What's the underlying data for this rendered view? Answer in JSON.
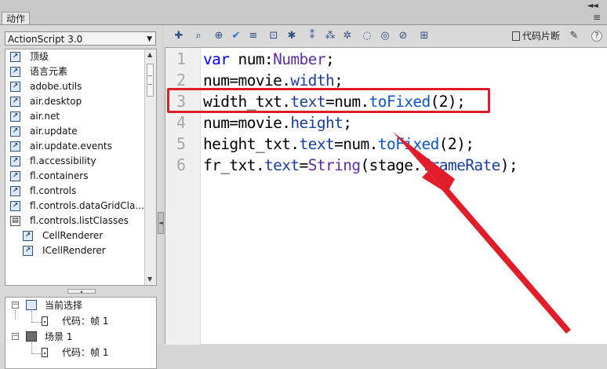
{
  "panel": {
    "tab_label": "动作",
    "collapse_glyph": "◄◄",
    "menu_glyph": "≡"
  },
  "left": {
    "dropdown_value": "ActionScript 3.0",
    "tree_items": [
      {
        "label": "顶级",
        "level": 0,
        "icon": "package-icon"
      },
      {
        "label": "语言元素",
        "level": 0,
        "icon": "package-icon"
      },
      {
        "label": "adobe.utils",
        "level": 0,
        "icon": "package-icon"
      },
      {
        "label": "air.desktop",
        "level": 0,
        "icon": "package-icon"
      },
      {
        "label": "air.net",
        "level": 0,
        "icon": "package-icon"
      },
      {
        "label": "air.update",
        "level": 0,
        "icon": "package-icon"
      },
      {
        "label": "air.update.events",
        "level": 0,
        "icon": "package-icon"
      },
      {
        "label": "fl.accessibility",
        "level": 0,
        "icon": "package-icon"
      },
      {
        "label": "fl.containers",
        "level": 0,
        "icon": "package-icon"
      },
      {
        "label": "fl.controls",
        "level": 0,
        "icon": "package-icon"
      },
      {
        "label": "fl.controls.dataGridCla...",
        "level": 0,
        "icon": "package-icon"
      },
      {
        "label": "fl.controls.listClasses",
        "level": 0,
        "icon": "open-package-icon"
      },
      {
        "label": "CellRenderer",
        "level": 1,
        "icon": "class-icon"
      },
      {
        "label": "ICellRenderer",
        "level": 1,
        "icon": "class-icon"
      }
    ],
    "scene_items": [
      {
        "label": "当前选择",
        "type": "group"
      },
      {
        "label": "代码：帧 1",
        "type": "frame"
      },
      {
        "label": "场景 1",
        "type": "scene"
      },
      {
        "label": "代码：帧 1",
        "type": "frame"
      }
    ]
  },
  "toolbar": {
    "snippets_label": "代码片断",
    "buttons": [
      "add-item",
      "find",
      "target-path",
      "check-syntax",
      "auto-format",
      "show-code-hint",
      "debug-options",
      "collapse-braces",
      "collapse-selection",
      "expand-all",
      "apply-block-comment",
      "apply-line-comment",
      "remove-comment",
      "show-hide-toolbox"
    ]
  },
  "editor": {
    "line_numbers": [
      "1",
      "2",
      "3",
      "4",
      "5",
      "6"
    ],
    "lines": [
      "var num:Number;",
      "num=movie.width;",
      "width_txt.text=num.toFixed(2);",
      "num=movie.height;",
      "height_txt.text=num.toFixed(2);",
      "fr_txt.text=String(stage.frameRate);"
    ],
    "highlighted_line": 3
  },
  "colors": {
    "annotation": "#e21d2a",
    "keyword": "#0000ff",
    "type": "#5c2daa"
  }
}
